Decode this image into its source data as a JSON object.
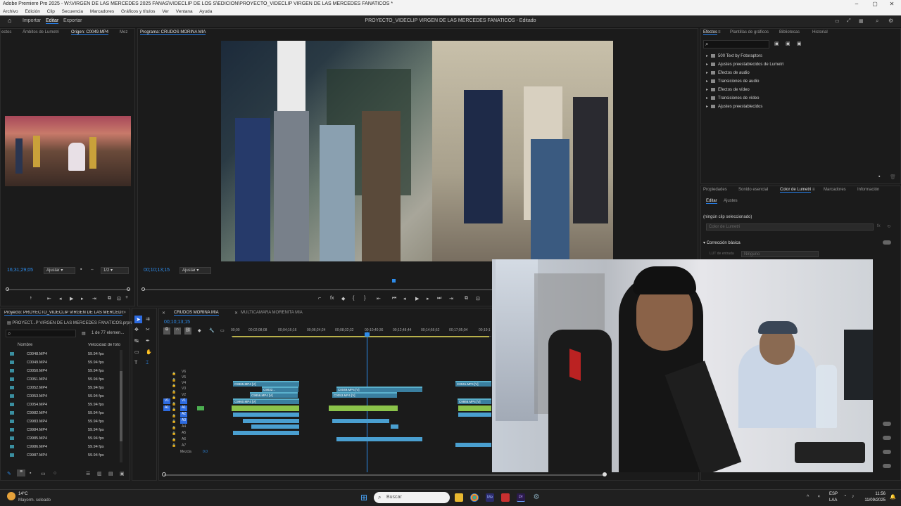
{
  "window": {
    "title": "Adobe Premiere Pro 2025 - W:\\VIRGEN DE LAS MERCEDES 2025 FANAS\\VIDECLIP DE LOS S\\EDICION\\PROYECTO_VIDECLIP VIRGEN DE LAS MERCEDES FANATICOS *"
  },
  "menu": [
    "Archivo",
    "Edición",
    "Clip",
    "Secuencia",
    "Marcadores",
    "Gráficos y títulos",
    "Ver",
    "Ventana",
    "Ayuda"
  ],
  "header": {
    "tabs": [
      "Importar",
      "Editar",
      "Exportar"
    ],
    "active_tab": "Editar",
    "project_title": "PROYECTO_VIDECLIP VIRGEN DE LAS MERCEDES FANATICOS - Editado"
  },
  "source_panel": {
    "tabs": [
      "ectos",
      "Ámbitos de Lumetri",
      "Origen: C0049.MP4",
      "Mez"
    ],
    "timecode": "16;31;29;05",
    "fit": "Ajustar",
    "resolution": "1/2"
  },
  "program_panel": {
    "tab": "Programa: CRUDOS MORINA MIA",
    "timecode": "00;10;13;15",
    "fit": "Ajustar"
  },
  "effects_panel": {
    "tabs": [
      "Efectos",
      "Plantillas de gráficos",
      "Bibliotecas",
      "Historial"
    ],
    "items": [
      "500 Text by Fotoraptors",
      "Ajustes preestablecidos de Lumetri",
      "Efectos de audio",
      "Transiciones de audio",
      "Efectos de vídeo",
      "Transiciones de vídeo",
      "Ajustes preestablecidos"
    ]
  },
  "lumetri_panel": {
    "tabs": [
      "Propiedades",
      "Sonido esencial",
      "Color de Lumetri",
      "Marcadores",
      "Información"
    ],
    "subtabs": [
      "Editar",
      "Ajustes"
    ],
    "no_clip": "(ningún clip seleccionado)",
    "preset": "Color de Lumetri",
    "section": "Corrección básica",
    "lut_label": "LUT de entrada",
    "lut_value": "Ninguno"
  },
  "project_panel": {
    "tab": "Proyecto: PROYECTO_VIDECLIP VIRGEN DE LAS MERCEDES FANATI",
    "file": "PROYECT...P VIRGEN DE LAS MERCEDES FANATICOS.prproj",
    "count": "1 de 77 elemen...",
    "col_name": "Nombre",
    "col_fps": "Velocidad de fotog",
    "clips": [
      {
        "name": "C0048.MP4",
        "fps": "59.94 fps"
      },
      {
        "name": "C0049.MP4",
        "fps": "59.94 fps"
      },
      {
        "name": "C0050.MP4",
        "fps": "59.94 fps"
      },
      {
        "name": "C0051.MP4",
        "fps": "59.94 fps"
      },
      {
        "name": "C0052.MP4",
        "fps": "59.94 fps"
      },
      {
        "name": "C0053.MP4",
        "fps": "59.94 fps"
      },
      {
        "name": "C0054.MP4",
        "fps": "59.94 fps"
      },
      {
        "name": "C9982.MP4",
        "fps": "59.94 fps"
      },
      {
        "name": "C9983.MP4",
        "fps": "59.94 fps"
      },
      {
        "name": "C9984.MP4",
        "fps": "59.94 fps"
      },
      {
        "name": "C9985.MP4",
        "fps": "59.94 fps"
      },
      {
        "name": "C9986.MP4",
        "fps": "59.94 fps"
      },
      {
        "name": "C9987.MP4",
        "fps": "59.94 fps"
      }
    ]
  },
  "timeline": {
    "tabs": [
      "CRUDOS MORINA MIA",
      "MULTICAMARA MORENITA MIA"
    ],
    "timecode": "00;10;13;15",
    "ruler": [
      "00;00",
      "00;02;08;08",
      "00;04;16;16",
      "00;06;24;24",
      "00;08;32;32",
      "00;10;40;36",
      "00;12;48;44",
      "00;14;56;52",
      "00;17;05;04",
      "00;19;1"
    ],
    "video_tracks": [
      "V6",
      "V5",
      "V4",
      "V3",
      "V2",
      "V1"
    ],
    "audio_tracks": [
      "A1",
      "A2",
      "A3",
      "A4",
      "A5",
      "A6",
      "A7"
    ],
    "mix_label": "Mezcla",
    "mix_value": "0.0",
    "clip_labels": [
      "C9965.MP4 [V]",
      "C9032...",
      "C9856.MP4 [V]",
      "C9960.MP4 [V]",
      "C0049.MP4 [V]",
      "C0053.MP4 [V]",
      "C0041.MP4 [V]",
      "C9866.MP4 [V]"
    ]
  },
  "taskbar": {
    "temp": "14°C",
    "weather": "Mayorm. soleado",
    "search": "Buscar",
    "lang": "ESP",
    "lang2": "LAA",
    "time": "11:56",
    "date": "11/09/2025"
  }
}
